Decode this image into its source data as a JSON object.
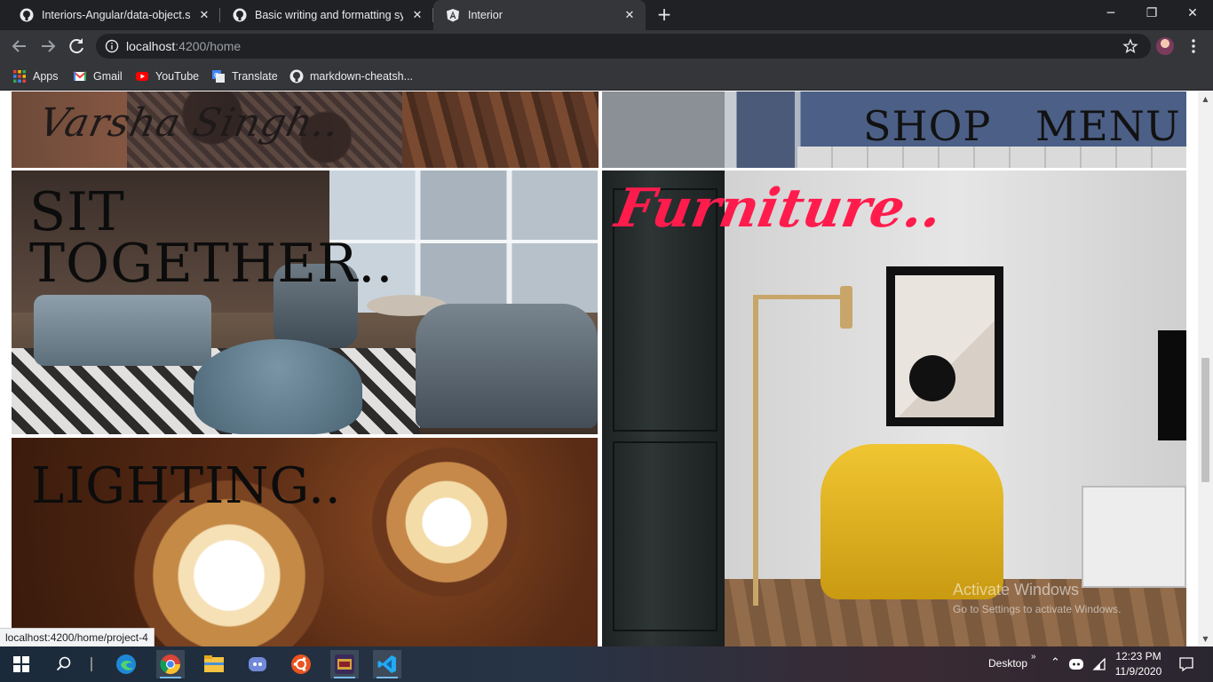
{
  "browser": {
    "tabs": [
      {
        "label": "Interiors-Angular/data-object.ser",
        "icon": "github-icon"
      },
      {
        "label": "Basic writing and formatting synt",
        "icon": "github-icon"
      },
      {
        "label": "Interior",
        "icon": "angular-icon"
      }
    ],
    "url_host": "localhost",
    "url_path": ":4200/home",
    "bookmarks": [
      {
        "label": "Apps",
        "icon": "apps-grid-icon"
      },
      {
        "label": "Gmail",
        "icon": "gmail-icon"
      },
      {
        "label": "YouTube",
        "icon": "youtube-icon"
      },
      {
        "label": "Translate",
        "icon": "translate-icon"
      },
      {
        "label": "markdown-cheatsh...",
        "icon": "github-icon"
      }
    ]
  },
  "page": {
    "signature": "Varsha Singh..",
    "nav": {
      "shop": "SHOP",
      "menu": "MENU"
    },
    "sections": {
      "sit_line1": "SIT",
      "sit_line2": "TOGETHER..",
      "lighting": "LIGHTING..",
      "furniture": "Furniture.."
    },
    "watermark": {
      "line1": "Activate Windows",
      "line2": "Go to Settings to activate Windows."
    },
    "status_link": "localhost:4200/home/project-4"
  },
  "taskbar": {
    "desktop_label": "Desktop",
    "time": "12:23 PM",
    "date": "11/9/2020"
  },
  "colors": {
    "accent_furniture": "#ff1c4d",
    "chrome_dark": "#202124",
    "chrome_toolbar": "#35363a"
  }
}
